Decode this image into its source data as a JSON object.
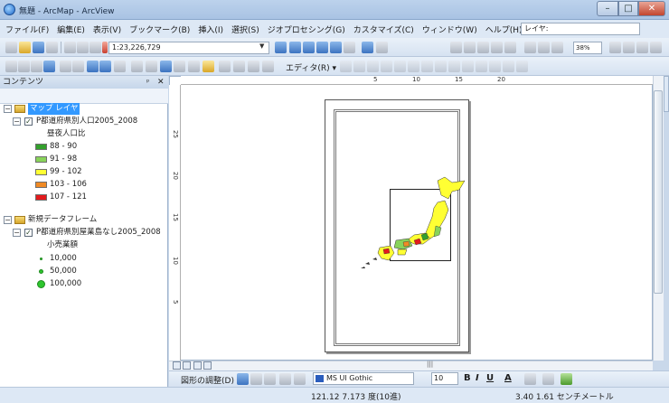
{
  "window": {
    "title": "無題 - ArcMap - ArcView",
    "minimize": "–",
    "maximize": "□",
    "close": "✕"
  },
  "menu": {
    "items": [
      "ファイル(F)",
      "編集(E)",
      "表示(V)",
      "ブックマーク(B)",
      "挿入(I)",
      "選択(S)",
      "ジオプロセシング(G)",
      "カスタマイズ(C)",
      "ウィンドウ(W)",
      "ヘルプ(H)"
    ],
    "layer_combo": "レイヤ:"
  },
  "toolbar": {
    "scale": "1:23,226,729",
    "zoom": "38%",
    "editor": "エディタ(R) ▾"
  },
  "toc": {
    "title": "コンテンツ",
    "pin": "ᵖ",
    "close": "✕",
    "frame1": {
      "name": "マップ レイヤ",
      "layer": {
        "name": "P都道府県別人口2005_2008",
        "field": "昼夜人口比",
        "classes": [
          {
            "label": "88 - 90",
            "color": "#33a02c"
          },
          {
            "label": "91 - 98",
            "color": "#88d35a"
          },
          {
            "label": "99 - 102",
            "color": "#ffff33"
          },
          {
            "label": "103 - 106",
            "color": "#f08a24"
          },
          {
            "label": "107 - 121",
            "color": "#e31a1c"
          }
        ]
      }
    },
    "frame2": {
      "name": "新規データフレーム",
      "layer": {
        "name": "P都道府県別屋業島なし2005_2008",
        "field": "小売業額",
        "classes": [
          {
            "label": "10,000"
          },
          {
            "label": "50,000"
          },
          {
            "label": "100,000"
          }
        ]
      }
    }
  },
  "map": {
    "ruler_top": [
      "5",
      "10",
      "15",
      "20"
    ],
    "ruler_left": [
      "25",
      "20",
      "15",
      "10",
      "5"
    ]
  },
  "draw": {
    "label": "図形の調整(D) ▾",
    "font": "MS UI Gothic",
    "size": "10",
    "bold": "B",
    "italic": "I",
    "underline": "U",
    "font_color": "A"
  },
  "status": {
    "coords": "121.12  7.173 度(10進)",
    "page": "3.40  1.61 センチメートル"
  }
}
